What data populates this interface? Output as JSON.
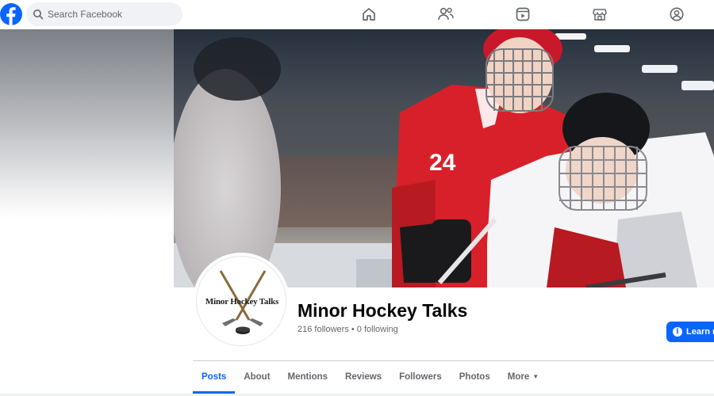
{
  "topbar": {
    "search_placeholder": "Search Facebook",
    "nav": [
      {
        "icon": "home-icon"
      },
      {
        "icon": "friends-icon"
      },
      {
        "icon": "video-icon"
      },
      {
        "icon": "marketplace-icon"
      },
      {
        "icon": "profile-icon"
      }
    ]
  },
  "profile": {
    "logo_text": "Minor Hockey Talks",
    "name": "Minor Hockey Talks",
    "stats": "216 followers • 0 following",
    "learn_more_label": "Learn m"
  },
  "tabs": [
    {
      "label": "Posts",
      "active": true
    },
    {
      "label": "About"
    },
    {
      "label": "Mentions"
    },
    {
      "label": "Reviews"
    },
    {
      "label": "Followers"
    },
    {
      "label": "Photos"
    },
    {
      "label": "More"
    }
  ],
  "colors": {
    "accent": "#0866ff",
    "secondary_text": "#65676b",
    "jersey_red": "#d8202a"
  },
  "cover": {
    "jersey_number": "24"
  }
}
